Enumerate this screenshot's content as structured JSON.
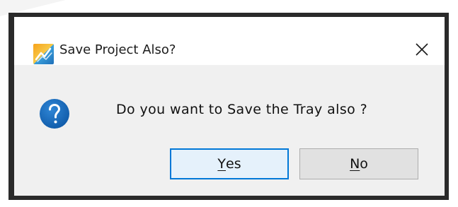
{
  "dialog": {
    "title": "Save Project Also?",
    "message": "Do you want to Save the Tray also ?",
    "icons": {
      "app": "app-logo-icon",
      "close": "close-icon",
      "question": "question-icon"
    },
    "buttons": {
      "yes": {
        "mnemonic": "Y",
        "rest": "es"
      },
      "no": {
        "mnemonic": "N",
        "rest": "o"
      }
    }
  },
  "colors": {
    "question_icon": "#1565c0",
    "default_button_border": "#0078d7",
    "default_button_bg": "#e5f1fb",
    "button_bg": "#e1e1e1"
  }
}
